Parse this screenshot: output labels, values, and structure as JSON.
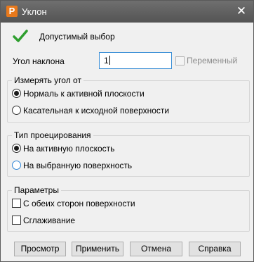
{
  "window": {
    "title": "Уклон",
    "app_icon": "app-logo-icon"
  },
  "status": {
    "icon": "checkmark-icon",
    "text": "Допустимый выбор",
    "color": "#2e9e2e"
  },
  "angle": {
    "label": "Угол наклона",
    "value": "1",
    "variable_label": "Переменный",
    "variable_checked": false,
    "variable_enabled": false
  },
  "measure": {
    "title": "Измерять угол от",
    "options": [
      {
        "label": "Нормаль к активной плоскости",
        "checked": true
      },
      {
        "label": "Касательная к исходной поверхности",
        "checked": false
      }
    ]
  },
  "projection": {
    "title": "Тип проецирования",
    "options": [
      {
        "label": "На активную плоскость",
        "checked": true
      },
      {
        "label": "На выбранную поверхность",
        "checked": false
      }
    ]
  },
  "params": {
    "title": "Параметры",
    "options": [
      {
        "label": "С обеих сторон поверхности",
        "checked": false
      },
      {
        "label": "Сглаживание",
        "checked": false
      }
    ]
  },
  "buttons": {
    "preview": "Просмотр",
    "apply": "Применить",
    "cancel": "Отмена",
    "help": "Справка"
  }
}
